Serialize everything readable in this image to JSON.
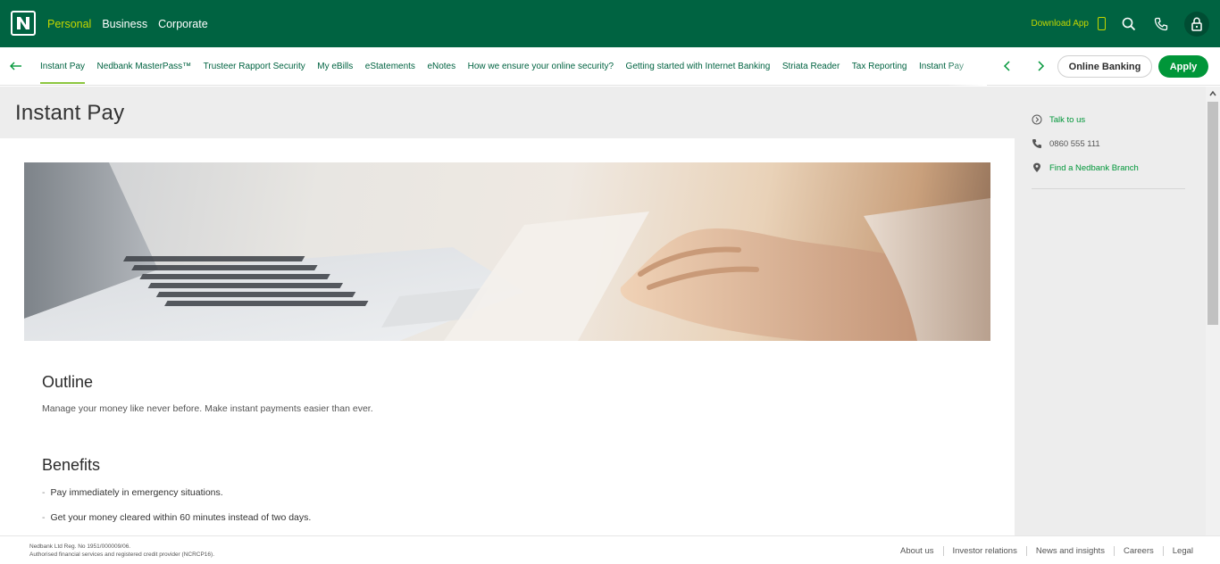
{
  "header": {
    "logo_icon": "nedbank-logo-icon",
    "segments": [
      {
        "label": "Personal",
        "active": true
      },
      {
        "label": "Business",
        "active": false
      },
      {
        "label": "Corporate",
        "active": false
      }
    ],
    "download_app_label": "Download App",
    "icons": [
      "mobile-phone-icon",
      "search-icon",
      "phone-icon",
      "lock-icon"
    ],
    "colors": {
      "brand": "#006341",
      "accent": "#c4d600",
      "button_green": "#009639"
    }
  },
  "subnav": {
    "links": [
      {
        "label": "Instant Pay",
        "active": true
      },
      {
        "label": "Nedbank MasterPass™",
        "active": false
      },
      {
        "label": "Trusteer Rapport Security",
        "active": false
      },
      {
        "label": "My eBills",
        "active": false
      },
      {
        "label": "eStatements",
        "active": false
      },
      {
        "label": "eNotes",
        "active": false
      },
      {
        "label": "How we ensure your online security?",
        "active": false
      },
      {
        "label": "Getting started with Internet Banking",
        "active": false
      },
      {
        "label": "Striata Reader",
        "active": false
      },
      {
        "label": "Tax Reporting",
        "active": false
      },
      {
        "label": "Instant Pay",
        "active": false
      }
    ],
    "online_banking_label": "Online Banking",
    "apply_label": "Apply"
  },
  "main": {
    "page_title": "Instant Pay",
    "outline_title": "Outline",
    "outline_text": "Manage your money like never before. Make instant payments easier than ever.",
    "benefits_title": "Benefits",
    "benefits": [
      "Pay immediately in emergency situations.",
      "Get your money cleared within 60 minutes instead of two days."
    ]
  },
  "sidebar": {
    "talk_label": "Talk to us",
    "phone_number": "0860 555 111",
    "branch_label": "Find a Nedbank Branch"
  },
  "footer": {
    "legal_line1": "Nedbank Ltd Reg. No 1951/000009/06.",
    "legal_line2": "Authorised financial services and registered credit provider (NCRCP16).",
    "links": [
      "About us",
      "Investor relations",
      "News and insights",
      "Careers",
      "Legal"
    ]
  }
}
